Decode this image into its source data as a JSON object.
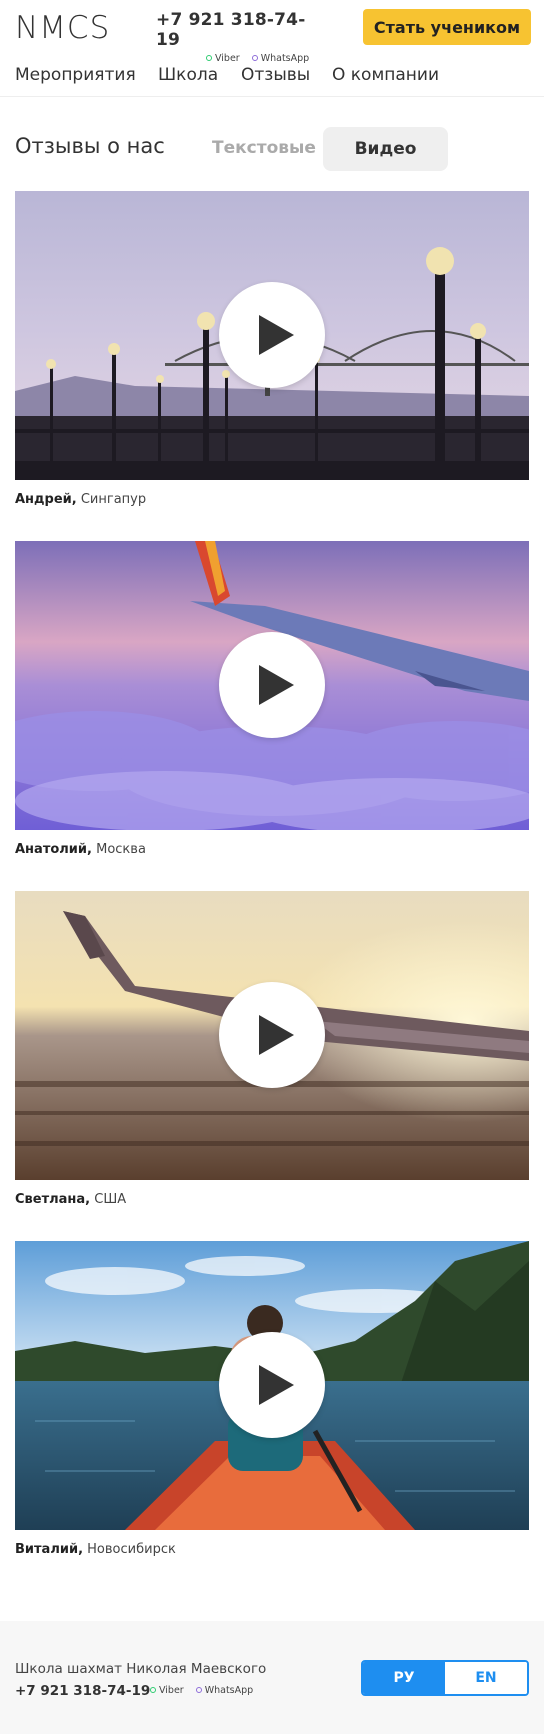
{
  "header": {
    "logo": "NMCS",
    "phone": "+7 921 318-74-19",
    "viber": "Viber",
    "whatsapp": "WhatsApp",
    "cta_label": "Стать учеником"
  },
  "nav": {
    "items": [
      {
        "label": "Мероприятия"
      },
      {
        "label": "Школа"
      },
      {
        "label": "Отзывы"
      },
      {
        "label": "О компании"
      }
    ]
  },
  "reviews": {
    "title": "Отзывы о нас",
    "tab_text": "Текстовые",
    "tab_video": "Видео",
    "videos": [
      {
        "name": "Андрей,",
        "city": "Сингапур"
      },
      {
        "name": "Анатолий,",
        "city": "Москва"
      },
      {
        "name": "Светлана,",
        "city": "США"
      },
      {
        "name": "Виталий,",
        "city": "Новосибирск"
      }
    ]
  },
  "footer": {
    "title": "Школа шахмат Николая Маевского",
    "phone": "+7 921 318-74-19",
    "viber": "Viber",
    "whatsapp": "WhatsApp",
    "lang_ru": "РУ",
    "lang_en": "EN"
  },
  "colors": {
    "cta": "#f7c331",
    "lang_accent": "#1e8ef0",
    "viber": "#2ecc71",
    "whatsapp": "#8e6cd9"
  }
}
